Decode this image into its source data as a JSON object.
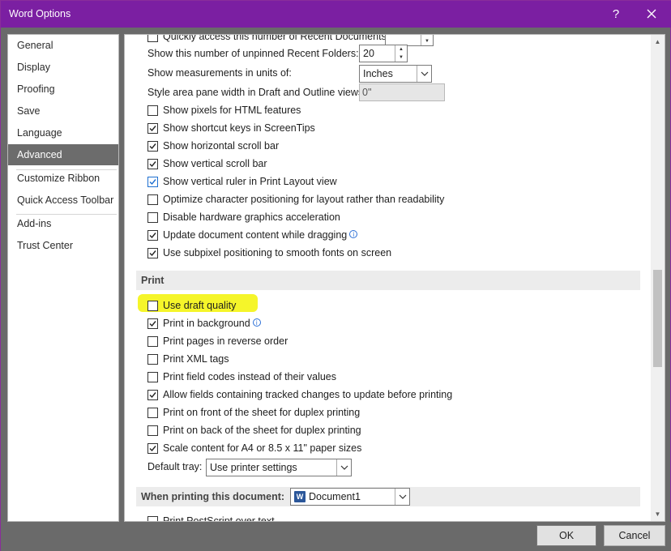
{
  "window": {
    "title": "Word Options",
    "help": "?",
    "accent": "#7b1fa2"
  },
  "sidebar": {
    "items": [
      {
        "label": "General"
      },
      {
        "label": "Display"
      },
      {
        "label": "Proofing"
      },
      {
        "label": "Save"
      },
      {
        "label": "Language"
      },
      {
        "label": "Advanced",
        "active": true
      },
      {
        "label": "Customize Ribbon"
      },
      {
        "label": "Quick Access Toolbar"
      },
      {
        "label": "Add-ins"
      },
      {
        "label": "Trust Center"
      }
    ]
  },
  "display": {
    "partial_top_label": "Quickly access this number of Recent Documents:",
    "recent_folders_label": "Show this number of unpinned Recent Folders:",
    "recent_folders_value": "20",
    "measurements_label": "Show measurements in units of:",
    "measurements_value": "Inches",
    "style_area_label": "Style area pane width in Draft and Outline views:",
    "style_area_value": "0\"",
    "checkboxes": [
      {
        "label": "Show pixels for HTML features",
        "checked": false
      },
      {
        "label": "Show shortcut keys in ScreenTips",
        "checked": true
      },
      {
        "label": "Show horizontal scroll bar",
        "checked": true
      },
      {
        "label": "Show vertical scroll bar",
        "checked": true
      },
      {
        "label": "Show vertical ruler in Print Layout view",
        "checked": true
      },
      {
        "label": "Optimize character positioning for layout rather than readability",
        "checked": false
      },
      {
        "label": "Disable hardware graphics acceleration",
        "checked": false
      },
      {
        "label": "Update document content while dragging",
        "checked": true,
        "info": true
      },
      {
        "label": "Use subpixel positioning to smooth fonts on screen",
        "checked": true
      }
    ]
  },
  "print": {
    "header": "Print",
    "checkboxes": [
      {
        "label": "Use draft quality",
        "checked": false,
        "highlighted": true
      },
      {
        "label": "Print in background",
        "checked": true,
        "info": true
      },
      {
        "label": "Print pages in reverse order",
        "checked": false
      },
      {
        "label": "Print XML tags",
        "checked": false
      },
      {
        "label": "Print field codes instead of their values",
        "checked": false
      },
      {
        "label": "Allow fields containing tracked changes to update before printing",
        "checked": true
      },
      {
        "label": "Print on front of the sheet for duplex printing",
        "checked": false
      },
      {
        "label": "Print on back of the sheet for duplex printing",
        "checked": false
      },
      {
        "label": "Scale content for A4 or 8.5 x 11\" paper sizes",
        "checked": true
      }
    ],
    "default_tray_label": "Default tray:",
    "default_tray_value": "Use printer settings"
  },
  "when_printing": {
    "header": "When printing this document:",
    "document_value": "Document1",
    "partial_bottom_label": "Print PostScript over text"
  },
  "buttons": {
    "ok": "OK",
    "cancel": "Cancel"
  },
  "colors": {
    "highlight": "#f5f52a",
    "active_nav": "#6c6c6c"
  }
}
